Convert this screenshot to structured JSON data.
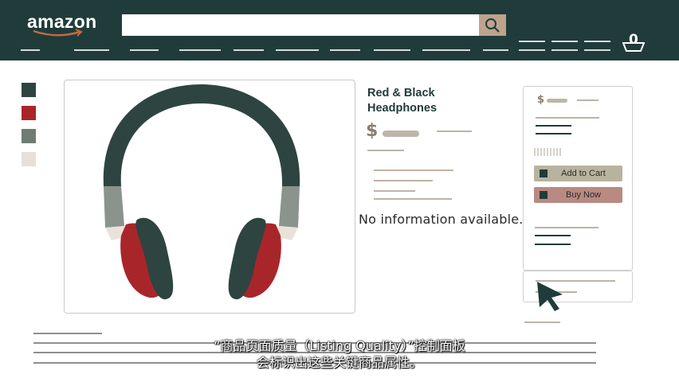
{
  "header": {
    "logo_text": "amazon",
    "search": {
      "placeholder": "",
      "value": "",
      "button_icon": "search-icon"
    },
    "cart": {
      "count": "0",
      "icon": "cart-icon"
    },
    "colors": {
      "background": "#203c3a",
      "search_button": "#bfa38d"
    }
  },
  "swatches": [
    {
      "name": "dark-green",
      "color": "#2e4440"
    },
    {
      "name": "red",
      "color": "#a8262a"
    },
    {
      "name": "gray-green",
      "color": "#6e7c74"
    },
    {
      "name": "light-beige",
      "color": "#e6e0d8"
    }
  ],
  "product": {
    "title": "Red & Black Headphones",
    "price_symbol": "$",
    "no_info_text": "No information available."
  },
  "buy_box": {
    "price_symbol": "$",
    "add_to_cart_label": "Add to Cart",
    "buy_now_label": "Buy Now",
    "colors": {
      "add_to_cart": "#b8b39f",
      "buy_now": "#b98a82"
    }
  },
  "caption": {
    "line1": "“商品页面质量（Listing Quality）”控制面板",
    "line2": "会标识出这些关键商品属性。"
  }
}
